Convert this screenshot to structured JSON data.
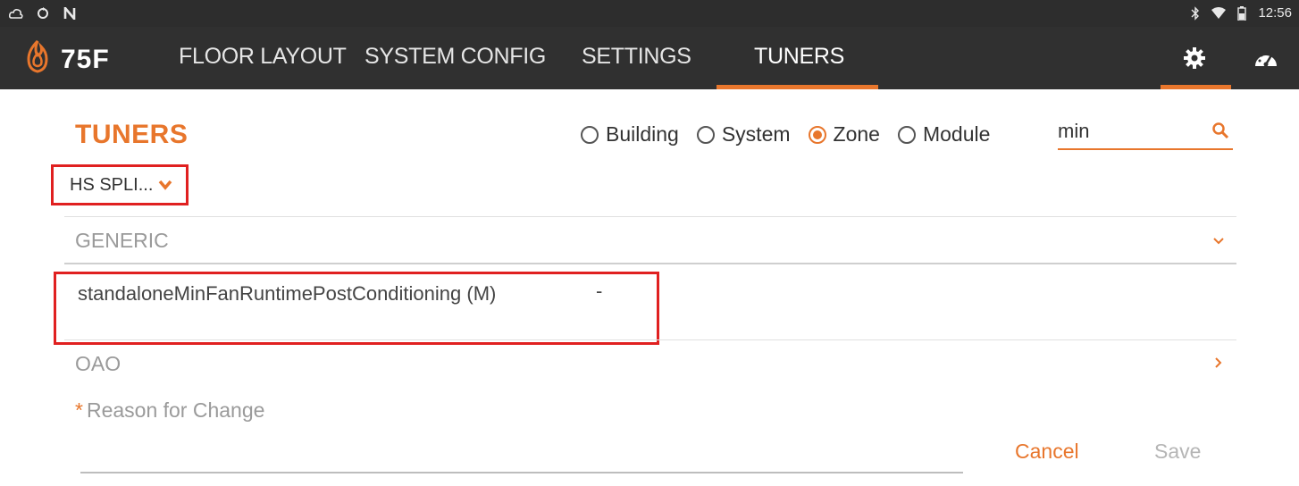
{
  "status_bar": {
    "time": "12:56",
    "left_icons": [
      "cloud-icon",
      "sync-icon",
      "notification-n-icon"
    ],
    "right_icons": [
      "bluetooth-icon",
      "wifi-icon",
      "battery-icon"
    ]
  },
  "app_bar": {
    "logo_text": "75F",
    "tabs": [
      {
        "label": "FLOOR LAYOUT",
        "active": false
      },
      {
        "label": "SYSTEM CONFIG",
        "active": false
      },
      {
        "label": "SETTINGS",
        "active": false
      },
      {
        "label": "TUNERS",
        "active": true
      }
    ],
    "icons": [
      "gear-icon",
      "dashboard-icon"
    ],
    "accent": "#e8762c"
  },
  "page": {
    "title": "TUNERS",
    "scope_options": [
      {
        "label": "Building",
        "selected": false
      },
      {
        "label": "System",
        "selected": false
      },
      {
        "label": "Zone",
        "selected": true
      },
      {
        "label": "Module",
        "selected": false
      }
    ],
    "search": {
      "value": "min",
      "placeholder": ""
    },
    "zone_dropdown": {
      "selected": "HS SPLI..."
    }
  },
  "sections": [
    {
      "label": "GENERIC",
      "expanded": true
    },
    {
      "label": "OAO",
      "expanded": false
    }
  ],
  "tuners": [
    {
      "name": "standaloneMinFanRuntimePostConditioning (M)",
      "value": "-"
    }
  ],
  "reason": {
    "required_mark": "*",
    "label": "Reason for Change"
  },
  "actions": {
    "cancel": "Cancel",
    "save": "Save"
  }
}
